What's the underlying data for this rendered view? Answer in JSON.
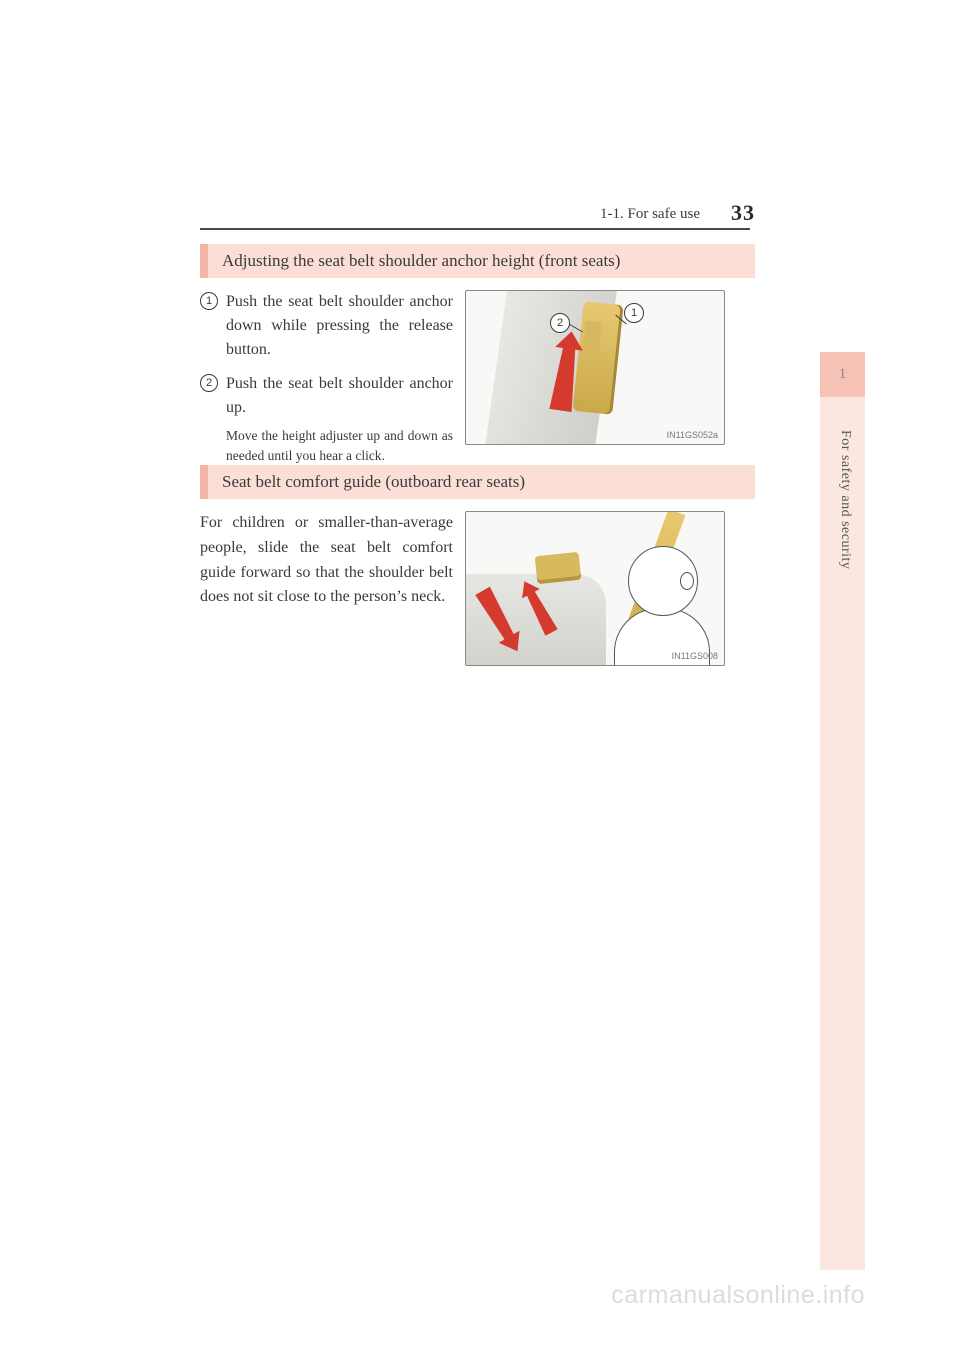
{
  "header": {
    "section": "1-1. For safe use",
    "page": "33"
  },
  "sidebar": {
    "chapter": "1",
    "title": "For safety and security"
  },
  "sections": [
    {
      "heading": "Adjusting the seat belt shoulder anchor height (front seats)",
      "steps": [
        {
          "num": "1",
          "text": "Push the seat belt shoulder anchor down while pressing the release button."
        },
        {
          "num": "2",
          "text": "Push the seat belt shoulder anchor up.",
          "note": "Move the height adjuster up and down as needed until you hear a click."
        }
      ],
      "figure_id": "IN11GS052a",
      "figure_callouts": [
        "1",
        "2"
      ]
    },
    {
      "heading": "Seat belt comfort guide (outboard rear seats)",
      "paragraph": "For children or smaller-than-average people, slide the seat belt comfort guide forward so that the shoulder belt does not sit close to the person’s neck.",
      "figure_id": "IN11GS008"
    }
  ],
  "watermark": "carmanualsonline.info"
}
